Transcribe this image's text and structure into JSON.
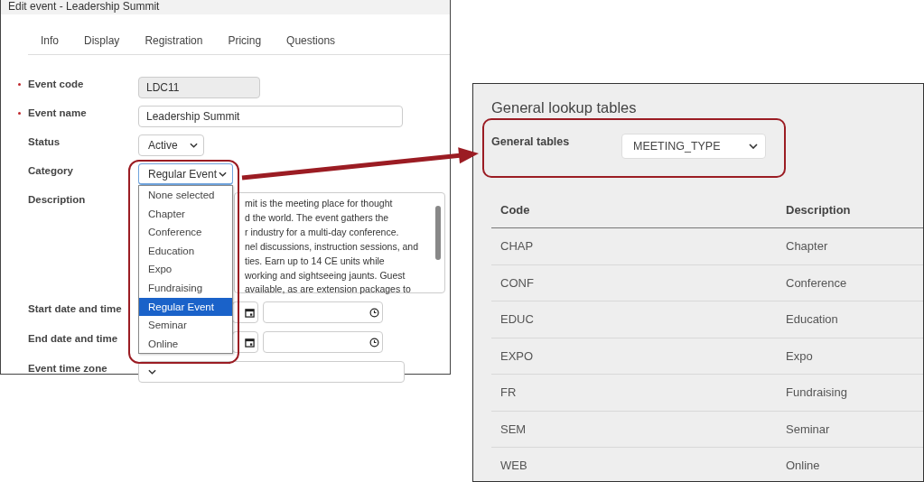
{
  "edit_event": {
    "title": "Edit event - Leadership Summit",
    "tabs": [
      {
        "label": "Info",
        "selected": false
      },
      {
        "label": "Display",
        "selected": false
      },
      {
        "label": "Registration",
        "selected": false
      },
      {
        "label": "Pricing",
        "selected": false
      },
      {
        "label": "Questions",
        "selected": false
      }
    ],
    "fields": [
      {
        "kind": "readonly",
        "label": "Event code",
        "required": true,
        "value": "LDC11"
      },
      {
        "kind": "text",
        "label": "Event name",
        "required": true,
        "value": "Leadership Summit"
      },
      {
        "kind": "select",
        "label": "Status",
        "required": false,
        "value": "Active"
      },
      {
        "kind": "dropdown",
        "label": "Category",
        "required": false,
        "value": "Regular Event",
        "options": [
          {
            "label": "None selected",
            "selected": false
          },
          {
            "label": "Chapter",
            "selected": false
          },
          {
            "label": "Conference",
            "selected": false
          },
          {
            "label": "Education",
            "selected": false
          },
          {
            "label": "Expo",
            "selected": false
          },
          {
            "label": "Fundraising",
            "selected": false
          },
          {
            "label": "Regular Event",
            "selected": true
          },
          {
            "label": "Seminar",
            "selected": false
          },
          {
            "label": "Online",
            "selected": false
          }
        ]
      },
      {
        "kind": "textarea",
        "label": "Description",
        "required": false,
        "lines": [
          "mit is the meeting place for thought",
          "d the world. The event gathers the",
          "r industry for a multi-day conference.",
          "nel discussions, instruction sessions, and",
          "ties. Earn up to 14 CE units while",
          "working and sightseeing jaunts. Guest",
          "available, as are extension packages to"
        ]
      },
      {
        "kind": "datetime",
        "label": "Start date and time",
        "required": false
      },
      {
        "kind": "datetime",
        "label": "End date and time",
        "required": false
      },
      {
        "kind": "select",
        "label": "Event time zone",
        "required": false
      }
    ]
  },
  "lookup": {
    "title": "General lookup tables",
    "filter_label": "General tables",
    "filter_value": "MEETING_TYPE",
    "columns": [
      "Code",
      "Description"
    ],
    "rows": [
      [
        "CHAP",
        "Chapter"
      ],
      [
        "CONF",
        "Conference"
      ],
      [
        "EDUC",
        "Education"
      ],
      [
        "EXPO",
        "Expo"
      ],
      [
        "FR",
        "Fundraising"
      ],
      [
        "SEM",
        "Seminar"
      ],
      [
        "WEB",
        "Online"
      ]
    ]
  }
}
